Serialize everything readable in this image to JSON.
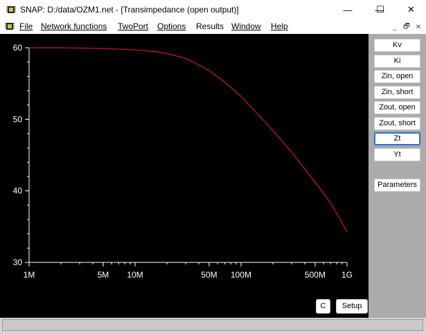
{
  "window": {
    "title": "SNAP: D:/data/OZM1.net - [Transimpedance (open output)]",
    "minimize_glyph": "—",
    "maximize_glyph": "☐",
    "close_glyph": "✕"
  },
  "menu": {
    "items": [
      "File",
      "Network functions",
      "TwoPort",
      "Options",
      "Results",
      "Window",
      "Help"
    ],
    "mdi_minimize": "_",
    "mdi_restore": "🗗",
    "mdi_close": "✕"
  },
  "side_buttons": [
    "Kv",
    "Ki",
    "Zin, open",
    "Zin, short",
    "Zout, open",
    "Zout, short",
    "Zt",
    "Yt"
  ],
  "parameters_button": "Parameters",
  "plot_buttons": {
    "c": "C",
    "setup": "Setup"
  },
  "colors": {
    "plot_background": "#000000",
    "trace": "#c8102e",
    "axis": "#ffffff",
    "client": "#ababab"
  },
  "chart_data": {
    "type": "line",
    "x_scale": "log",
    "xlim": [
      1000000,
      1000000000
    ],
    "ylim": [
      30,
      60
    ],
    "x_ticks": [
      {
        "value": 1000000,
        "label": "1M"
      },
      {
        "value": 5000000,
        "label": "5M"
      },
      {
        "value": 10000000,
        "label": "10M"
      },
      {
        "value": 50000000,
        "label": "50M"
      },
      {
        "value": 100000000,
        "label": "100M"
      },
      {
        "value": 500000000,
        "label": "500M"
      },
      {
        "value": 1000000000,
        "label": "1G"
      }
    ],
    "y_ticks": [
      {
        "value": 30,
        "label": "30"
      },
      {
        "value": 40,
        "label": "40"
      },
      {
        "value": 50,
        "label": "50"
      },
      {
        "value": 60,
        "label": "60"
      }
    ],
    "series": [
      {
        "x": [
          1000000,
          2000000,
          5000000,
          10000000,
          15000000,
          20000000,
          30000000,
          40000000,
          50000000,
          70000000,
          100000000,
          150000000,
          200000000,
          300000000,
          500000000,
          700000000,
          1000000000
        ],
        "values": [
          60,
          60,
          59.9,
          59.7,
          59.5,
          59.2,
          58.5,
          57.6,
          56.8,
          55.2,
          53.2,
          50.4,
          48.4,
          45.4,
          41.2,
          38.3,
          34.3
        ]
      }
    ]
  }
}
